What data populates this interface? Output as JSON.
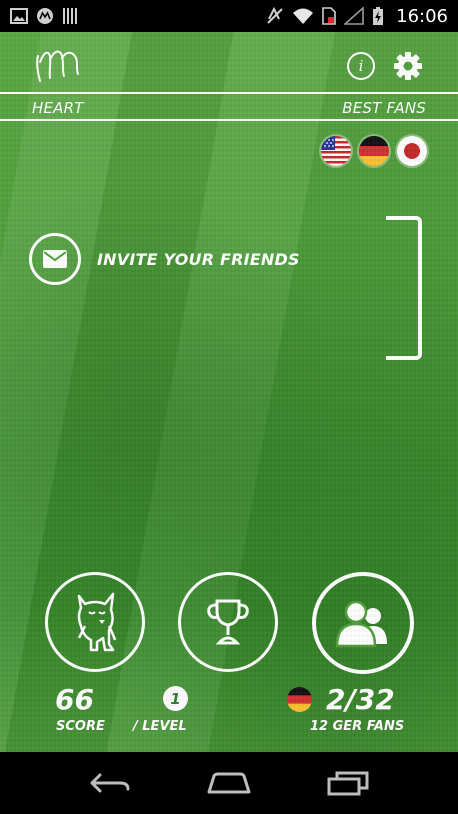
{
  "status_bar": {
    "time": "16:06",
    "left_icons": [
      "image-icon",
      "motorola-icon",
      "barcode-icon"
    ],
    "right_icons": [
      "mute-icon",
      "wifi-icon",
      "sim-icon",
      "signal-icon",
      "battery-charging-icon"
    ]
  },
  "header": {
    "left_tab": "HEART",
    "right_tab": "BEST FANS",
    "info_label": "i"
  },
  "languages": [
    "us-flag",
    "germany-flag",
    "japan-flag"
  ],
  "invite": {
    "label": "INVITE YOUR FRIENDS"
  },
  "stats": {
    "score_value": "66",
    "score_label": "SCORE",
    "level_value": "1",
    "level_label": "/ LEVEL",
    "fans_value": "2/32",
    "fans_label": "12 GER FANS"
  },
  "colors": {
    "grass": "#4f9f3b",
    "accent": "#ffffff"
  }
}
